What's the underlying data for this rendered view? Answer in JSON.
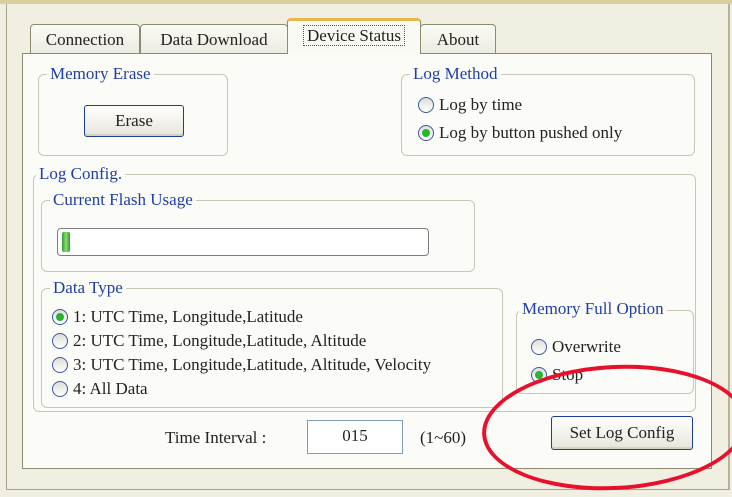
{
  "tabs": [
    {
      "label": "Connection",
      "active": false
    },
    {
      "label": "Data Download",
      "active": false
    },
    {
      "label": "Device Status",
      "active": true
    },
    {
      "label": "About",
      "active": false
    }
  ],
  "memory_erase": {
    "legend": "Memory Erase",
    "erase_button": "Erase"
  },
  "log_method": {
    "legend": "Log Method",
    "options": [
      {
        "label": "Log by time",
        "checked": false
      },
      {
        "label": "Log by button pushed only",
        "checked": true
      }
    ]
  },
  "log_config": {
    "legend": "Log Config.",
    "flash_usage": {
      "legend": "Current Flash Usage",
      "fraction": 0.02
    },
    "data_type": {
      "legend": "Data Type",
      "options": [
        {
          "label": "1: UTC Time, Longitude,Latitude",
          "checked": true
        },
        {
          "label": "2: UTC Time, Longitude,Latitude, Altitude",
          "checked": false
        },
        {
          "label": "3: UTC Time, Longitude,Latitude, Altitude, Velocity",
          "checked": false
        },
        {
          "label": "4: All Data",
          "checked": false
        }
      ]
    },
    "memory_full": {
      "legend": "Memory Full Option",
      "options": [
        {
          "label": "Overwrite",
          "checked": false
        },
        {
          "label": "Stop",
          "checked": true
        }
      ]
    },
    "time_interval": {
      "label": "Time Interval :",
      "value": "015",
      "range": "(1~60)"
    },
    "set_button": "Set Log Config"
  },
  "colors": {
    "accent": "#e8102a",
    "legend_text": "#1f3fa6",
    "radio_dot": "#27b42f",
    "active_tab_top": "#e8b64a"
  }
}
